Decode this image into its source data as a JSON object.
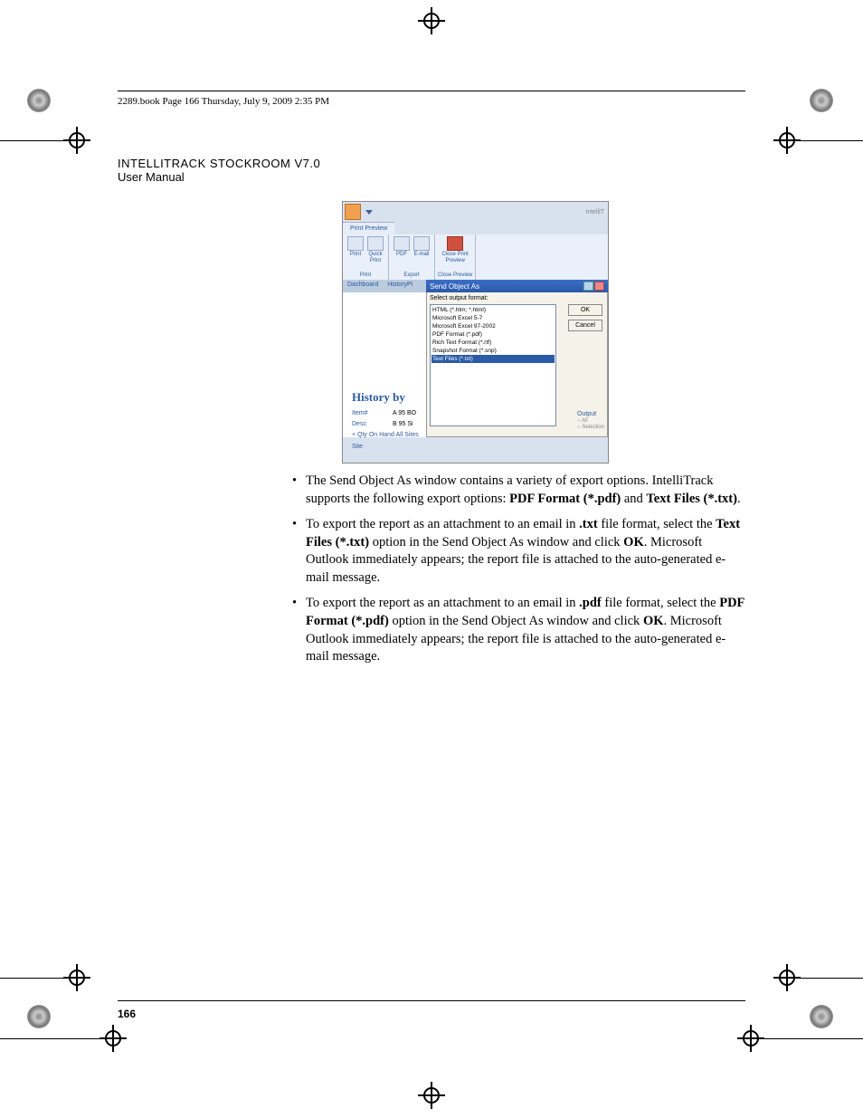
{
  "header": {
    "book_info": "2289.book  Page 166  Thursday, July 9, 2009  2:35 PM"
  },
  "doc_title": {
    "line1": "INTELLITRACK STOCKROOM V7.0",
    "line2": "User Manual"
  },
  "screenshot": {
    "brand": "IntelliT",
    "ribbon_tab": "Print Preview",
    "groups": {
      "print": {
        "print": "Print",
        "quick": "Quick\nPrint",
        "label": "Print"
      },
      "export": {
        "pdf": "PDF",
        "email": "E-mail",
        "label": "Export"
      },
      "close": {
        "close": "Close Print\nPreview",
        "label": "Close Preview"
      }
    },
    "tabs": {
      "dashboard": "Dashboard",
      "history": "HistoryPi"
    },
    "dialog": {
      "title": "Send Object As",
      "label": "Select output format:",
      "options": [
        "HTML (*.htm; *.html)",
        "Microsoft Excel 5-7",
        "Microsoft Excel 97-2002",
        "PDF Format (*.pdf)",
        "Rich Text Format (*.rtf)",
        "Snapshot Format (*.snp)",
        "Text Files (*.txt)"
      ],
      "ok": "OK",
      "cancel": "Cancel"
    },
    "body": {
      "heading": "History by",
      "rows": [
        {
          "c1": "Item#",
          "c2": "A 95 BO"
        },
        {
          "c1": "Desc",
          "c2": "B 95 Si"
        },
        {
          "c1": "+ Qty On Hand All Sites",
          "c2": ""
        },
        {
          "c1": "Site",
          "c2": ""
        }
      ],
      "output": "Output",
      "radio1": "All",
      "radio2": "Selection"
    }
  },
  "bullets": {
    "b1a": "The Send Object As window contains a variety of export options. IntelliTrack supports the following export options: ",
    "b1b": "PDF Format (*.pdf)",
    "b1c": " and ",
    "b1d": "Text Files (*.txt)",
    "b1e": ".",
    "b2a": "To export the report as an attachment to an email in ",
    "b2b": ".txt",
    "b2c": " file format, select the ",
    "b2d": "Text Files (*.txt)",
    "b2e": " option in the Send Object As window and click ",
    "b2f": "OK",
    "b2g": ". Microsoft Outlook immediately appears; the report file is attached to the auto-generated e-mail message.",
    "b3a": "To export the report as an attachment to an email in ",
    "b3b": ".pdf",
    "b3c": " file format, select the ",
    "b3d": "PDF Format (*.pdf)",
    "b3e": " option in the Send Object As window and click ",
    "b3f": "OK",
    "b3g": ". Microsoft Outlook immediately appears; the report file is attached to the auto-generated e-mail message."
  },
  "page_number": "166"
}
